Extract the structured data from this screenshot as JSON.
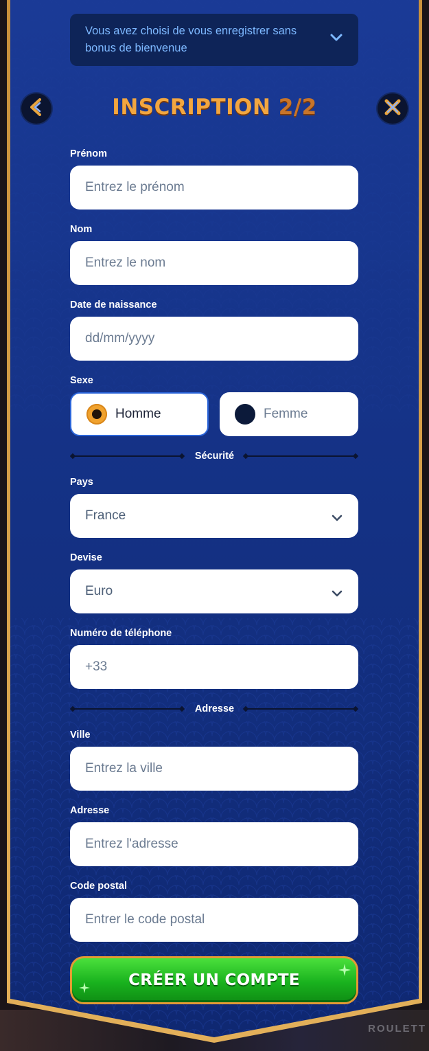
{
  "bonus_notice": {
    "text": "Vous avez choisi de vous enregistrer sans bonus de bienvenue",
    "icon": "chevron-down-icon"
  },
  "header": {
    "title": "INSCRIPTION",
    "step": "2/2",
    "back_icon": "back-arrow-icon",
    "close_icon": "close-icon"
  },
  "form": {
    "first_name": {
      "label": "Prénom",
      "placeholder": "Entrez le prénom",
      "value": ""
    },
    "last_name": {
      "label": "Nom",
      "placeholder": "Entrez le nom",
      "value": ""
    },
    "birth_date": {
      "label": "Date de naissance",
      "placeholder": "dd/mm/yyyy",
      "value": ""
    },
    "gender": {
      "label": "Sexe",
      "options": [
        {
          "label": "Homme",
          "selected": true
        },
        {
          "label": "Femme",
          "selected": false
        }
      ]
    },
    "security_section": "Sécurité",
    "country": {
      "label": "Pays",
      "value": "France"
    },
    "currency": {
      "label": "Devise",
      "value": "Euro"
    },
    "phone": {
      "label": "Numéro de téléphone",
      "placeholder": "+33",
      "value": ""
    },
    "address_section": "Adresse",
    "city": {
      "label": "Ville",
      "placeholder": "Entrez la ville",
      "value": ""
    },
    "address": {
      "label": "Adresse",
      "placeholder": "Entrez l'adresse",
      "value": ""
    },
    "postal_code": {
      "label": "Code postal",
      "placeholder": "Entrer le code postal",
      "value": ""
    }
  },
  "cta": {
    "label": "CRÉER UN COMPTE"
  },
  "background": {
    "game_text": "ROULETT"
  },
  "colors": {
    "panel": "#13318a",
    "accent_gold": "#f2a640",
    "cta_green": "#19b21e",
    "link_blue": "#7db8ff"
  }
}
